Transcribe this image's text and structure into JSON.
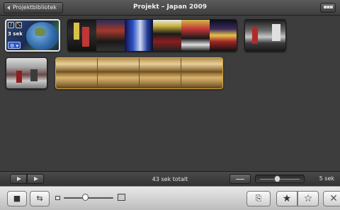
{
  "titlebar": {
    "back_label": "Projektbibliotek",
    "title": "Projekt – Japan 2009",
    "menu_glyph": "▪▪▪"
  },
  "clips": [
    {
      "id": "clip1",
      "duration_label": "3 sek",
      "gear_glyph": "⚙ ▾"
    },
    {
      "id": "clip2"
    },
    {
      "id": "clip3"
    },
    {
      "id": "clip4"
    },
    {
      "id": "clip5"
    }
  ],
  "playback_bar": {
    "total_label": "43 sek totalt",
    "duration_label": "5 sek",
    "duration_slider_value": 0.4
  },
  "toolbar": {
    "camera_glyph": "■",
    "swap_glyph": "⇆",
    "thumb_size_slider_value": 0.43,
    "action_glyph": "⎘",
    "star_solid_glyph": "★",
    "star_empty_glyph": "☆",
    "reject_glyph": "✕"
  }
}
